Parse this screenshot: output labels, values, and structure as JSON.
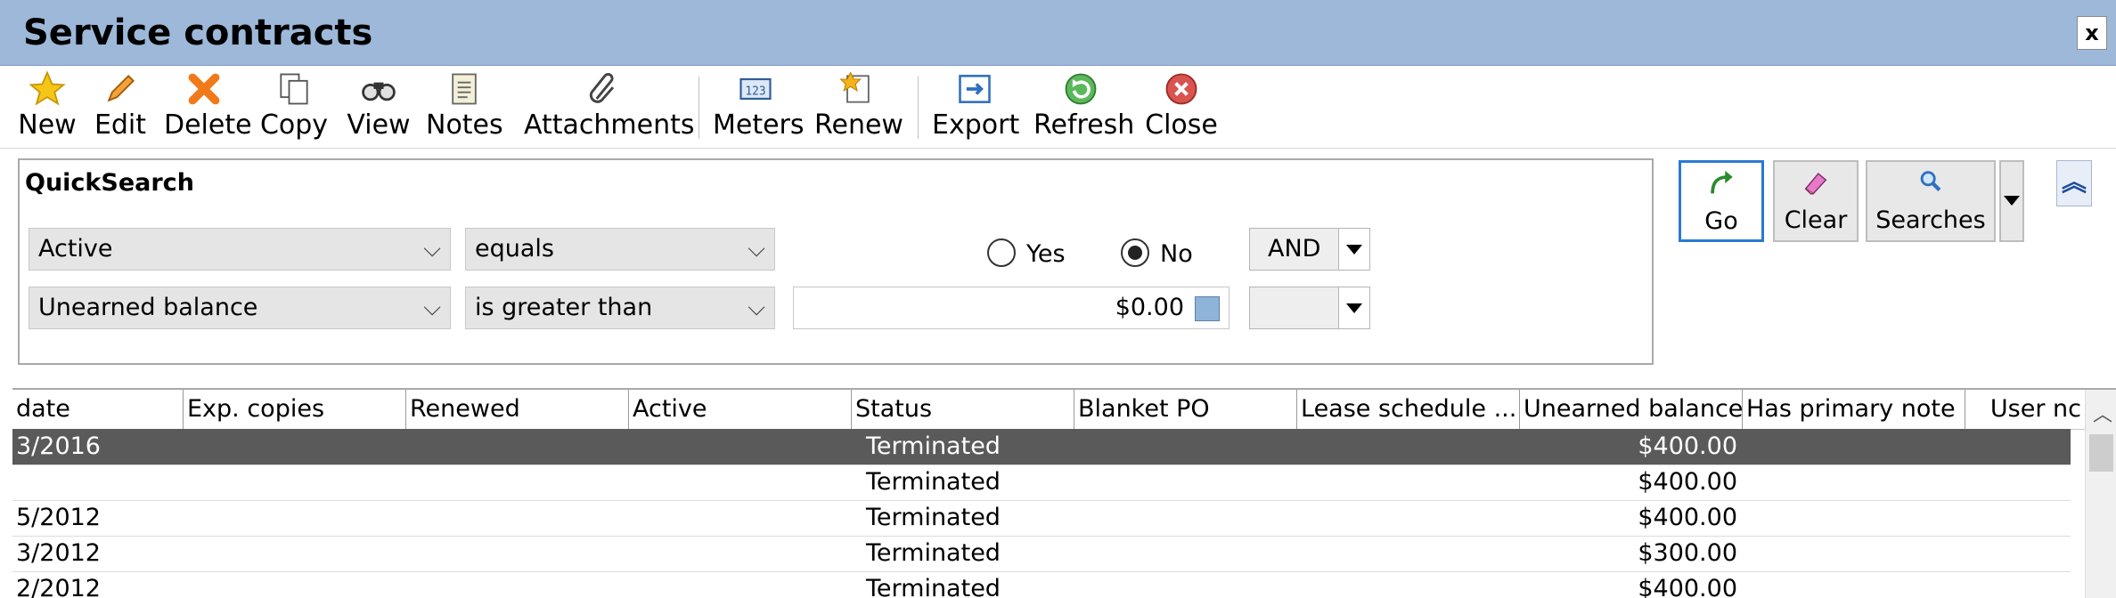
{
  "window": {
    "title": "Service contracts",
    "close_label": "x"
  },
  "toolbar": {
    "buttons": [
      {
        "label": "New",
        "icon": "star-icon"
      },
      {
        "label": "Edit",
        "icon": "pencil-icon"
      },
      {
        "label": "Delete",
        "icon": "delete-x-icon"
      },
      {
        "label": "Copy",
        "icon": "copy-icon"
      },
      {
        "label": "View",
        "icon": "binoculars-icon"
      },
      {
        "label": "Notes",
        "icon": "notes-icon"
      },
      {
        "label": "Attachments",
        "icon": "paperclip-icon"
      },
      {
        "label": "Meters",
        "icon": "meter-icon"
      },
      {
        "label": "Renew",
        "icon": "renew-icon"
      },
      {
        "label": "Export",
        "icon": "export-icon"
      },
      {
        "label": "Refresh",
        "icon": "refresh-icon"
      },
      {
        "label": "Close",
        "icon": "close-circle-icon"
      }
    ]
  },
  "quicksearch": {
    "title": "QuickSearch",
    "row1": {
      "field": "Active",
      "operator": "equals",
      "yes_label": "Yes",
      "no_label": "No",
      "selected": "No",
      "logic": "AND"
    },
    "row2": {
      "field": "Unearned balance",
      "operator": "is greater than",
      "value": "$0.00",
      "logic": ""
    }
  },
  "search_buttons": {
    "go": "Go",
    "clear": "Clear",
    "searches": "Searches"
  },
  "grid": {
    "columns": [
      "date",
      "Exp. copies",
      "Renewed",
      "Active",
      "Status",
      "Blanket PO",
      "Lease schedule ...",
      "Unearned balance",
      "Has primary note",
      "User nc"
    ],
    "rows": [
      {
        "date": "3/2016",
        "status": "Terminated",
        "balance": "$400.00",
        "selected": true
      },
      {
        "date": "",
        "status": "Terminated",
        "balance": "$400.00",
        "selected": false
      },
      {
        "date": "5/2012",
        "status": "Terminated",
        "balance": "$400.00",
        "selected": false
      },
      {
        "date": "3/2012",
        "status": "Terminated",
        "balance": "$300.00",
        "selected": false
      },
      {
        "date": "2/2012",
        "status": "Terminated",
        "balance": "$400.00",
        "selected": false
      }
    ]
  }
}
